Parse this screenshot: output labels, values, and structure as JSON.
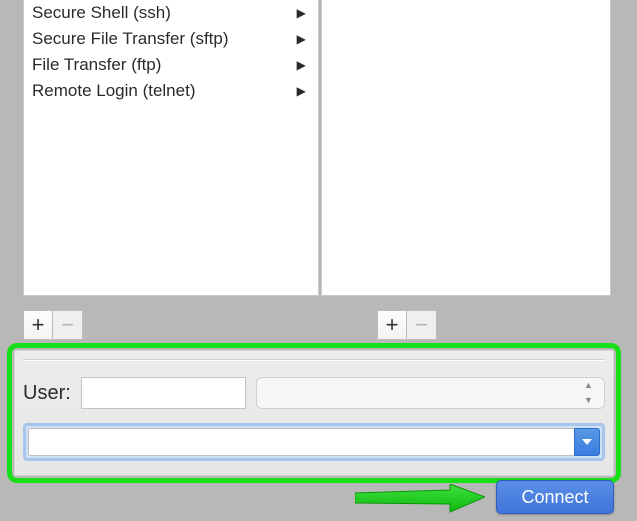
{
  "protocols": {
    "items": [
      {
        "label": "Secure Shell (ssh)",
        "hasSubmenu": true
      },
      {
        "label": "Secure File Transfer (sftp)",
        "hasSubmenu": true
      },
      {
        "label": "File Transfer (ftp)",
        "hasSubmenu": true
      },
      {
        "label": "Remote Login (telnet)",
        "hasSubmenu": true
      }
    ]
  },
  "toolbar": {
    "add": "+",
    "remove": "−"
  },
  "form": {
    "user_label": "User:",
    "user_value": "",
    "stepper_value": "",
    "combo_value": ""
  },
  "actions": {
    "connect": "Connect"
  },
  "colors": {
    "highlight": "#18e018",
    "button_primary": "#4a7fe0"
  }
}
